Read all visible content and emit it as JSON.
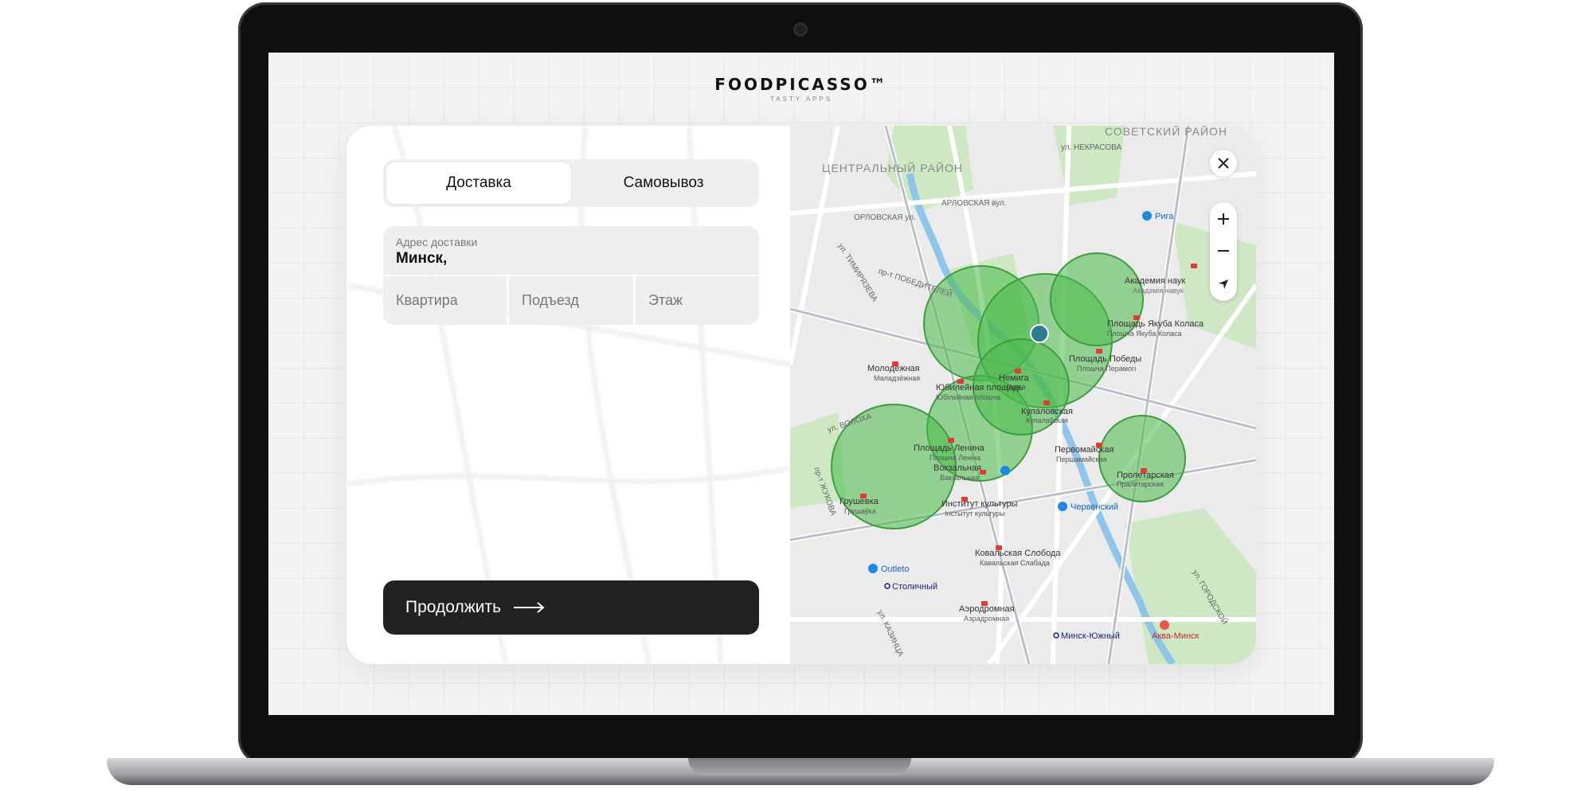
{
  "brand": {
    "name": "FOODPICASSO™",
    "tagline": "TASTY APPS"
  },
  "tabs": [
    {
      "label": "Доставка",
      "active": true
    },
    {
      "label": "Самовывоз",
      "active": false
    }
  ],
  "address": {
    "label": "Адрес доставки",
    "value": "Минск,"
  },
  "fields": {
    "apartment_placeholder": "Квартира",
    "entrance_placeholder": "Подъезд",
    "floor_placeholder": "Этаж"
  },
  "continue_label": "Продолжить",
  "map": {
    "controls": {
      "close": "×",
      "zoom_in": "+",
      "zoom_out": "−"
    },
    "districts": [
      "ЦЕНТРАЛЬНЫЙ РАЙОН",
      "СОВЕТСКИЙ РАЙОН"
    ],
    "streets": [
      "ул. НЕКРАСОВА",
      "ОРЛОВСКАЯ ул.",
      "АРЛОВСКАЯ вул.",
      "пр-т ПОБЕДИТЕЛЕЙ",
      "ул. ТИМИРЯЗЕВА",
      "ул. ВОЛОХА",
      "ул. ГОРОДСКОЙ",
      "пр-т ЖУКОВА",
      "ул. КАЗИНЦА"
    ],
    "stations": [
      {
        "name": "Академия наук",
        "alt": "Акадэмія навук"
      },
      {
        "name": "Площадь Якуба Коласа",
        "alt": "Плошча Якуба Коласа"
      },
      {
        "name": "Площадь Победы",
        "alt": "Плошча Перамогі"
      },
      {
        "name": "Молодёжная",
        "alt": "Маладзёжная"
      },
      {
        "name": "Немига",
        "alt": "Няміга"
      },
      {
        "name": "Юбилейная площадь",
        "alt": "Юбілейная плошча"
      },
      {
        "name": "Купаловская",
        "alt": "Купалаўская"
      },
      {
        "name": "Площадь Ленина",
        "alt": "Плошча Леніна"
      },
      {
        "name": "Первомайская",
        "alt": "Першамайская"
      },
      {
        "name": "Вокзальная",
        "alt": "Вакзальная"
      },
      {
        "name": "Пролетарская",
        "alt": "Пралетарская"
      },
      {
        "name": "Грушевка",
        "alt": "Грушаўка"
      },
      {
        "name": "Институт культуры",
        "alt": "Інстытут культуры"
      },
      {
        "name": "Ковальская Слобода",
        "alt": "Кавальская Слабада"
      },
      {
        "name": "Аэродромная",
        "alt": "Аэрадромная"
      }
    ],
    "places": [
      "Рига",
      "Червенский",
      "Outleto",
      "Столичный",
      "Минск-Южный",
      "Аква-Минск"
    ]
  }
}
